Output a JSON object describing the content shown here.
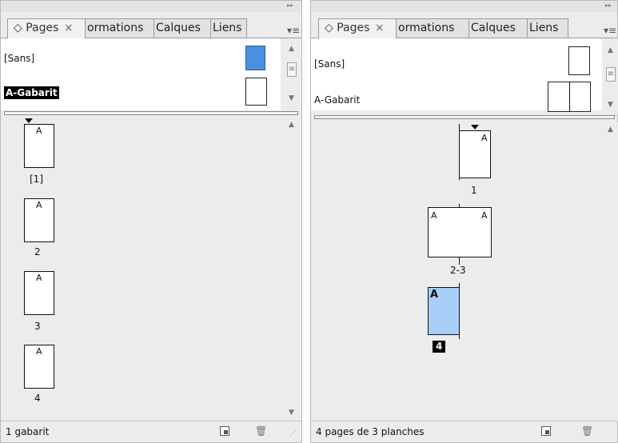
{
  "left_panel": {
    "tabs": [
      {
        "label": "◇ Pages",
        "close": "×"
      },
      {
        "label": "ormations"
      },
      {
        "label": "Calques"
      },
      {
        "label": "Liens"
      }
    ],
    "collapse_glyph": "▸▸",
    "menu_glyph": "▾≡",
    "masters": [
      {
        "label": "[Sans]"
      },
      {
        "label": "A-Gabarit"
      }
    ],
    "pages": [
      {
        "letter": "A",
        "label": "[1]"
      },
      {
        "letter": "A",
        "label": "2"
      },
      {
        "letter": "A",
        "label": "3"
      },
      {
        "letter": "A",
        "label": "4"
      }
    ],
    "status": "1 gabarit"
  },
  "right_panel": {
    "tabs": [
      {
        "label": "◇ Pages",
        "close": "×"
      },
      {
        "label": "ormations"
      },
      {
        "label": "Calques"
      },
      {
        "label": "Liens"
      }
    ],
    "collapse_glyph": "▸▸",
    "menu_glyph": "▾≡",
    "masters": [
      {
        "label": "[Sans]"
      },
      {
        "label": "A-Gabarit"
      }
    ],
    "spreads": [
      {
        "letters": [
          "A"
        ],
        "label": "1"
      },
      {
        "letters": [
          "A",
          "A"
        ],
        "label": "2-3"
      },
      {
        "letters": [
          "A"
        ],
        "label": "4"
      }
    ],
    "status": "4 pages de 3 planches"
  },
  "colors": {
    "panel_bg": "#ececec",
    "selected_master": "#4a90e2",
    "selected_page": "#a8cff8"
  },
  "icons": [
    "new-page-icon",
    "trash-icon",
    "panel-menu-icon",
    "collapse-icon",
    "resize-grip-icon"
  ]
}
